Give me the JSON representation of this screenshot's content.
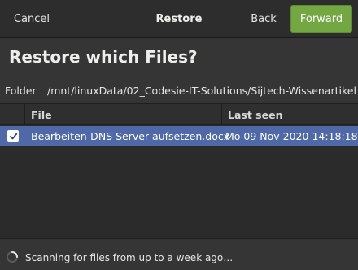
{
  "header": {
    "cancel_label": "Cancel",
    "title": "Restore",
    "back_label": "Back",
    "forward_label": "Forward",
    "accent_color": "#72a742"
  },
  "heading": "Restore which Files?",
  "folder": {
    "label": "Folder",
    "path": "/mnt/linuxData/02_Codesie-IT-Solutions/Sijtech-Wissenartikel"
  },
  "table": {
    "columns": [
      "File",
      "Last seen"
    ],
    "rows": [
      {
        "checked": true,
        "file": "Bearbeiten-DNS Server aufsetzen.docx",
        "last_seen": "Mo 09 Nov 2020 14:18:18"
      }
    ],
    "selected_color": "#4e68a8"
  },
  "status": {
    "text": "Scanning for files from up to a week ago…",
    "icon": "spinner-icon"
  }
}
